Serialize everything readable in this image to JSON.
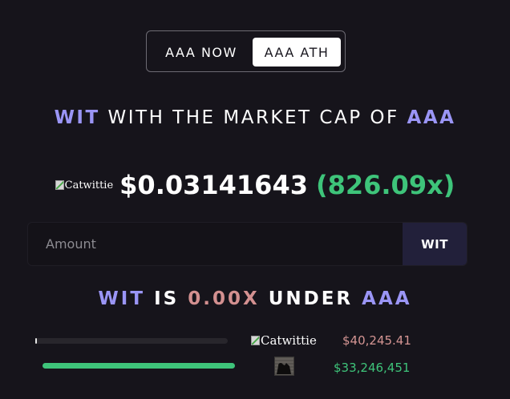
{
  "toggle": {
    "options": [
      "AAA NOW",
      "AAA ATH"
    ],
    "selected": "AAA ATH"
  },
  "heading": {
    "token": "WIT",
    "middle": "WITH THE MARKET CAP OF",
    "target": "AAA"
  },
  "price": {
    "image_alt": "Catwittie",
    "value": "$0.03141643",
    "multiplier": "(826.09x)"
  },
  "amount": {
    "placeholder": "Amount",
    "value": "",
    "unit": "WIT"
  },
  "comparison": {
    "token": "WIT",
    "is": "IS",
    "ratio": "0.00X",
    "under": "UNDER",
    "target": "AAA"
  },
  "rows": [
    {
      "image_alt": "Catwittie",
      "value": "$40,245.41",
      "bar_fraction": 0.0012,
      "bar_color": "#e6e6e6"
    },
    {
      "image_alt": "",
      "value": "$33,246,451",
      "bar_fraction": 1.0,
      "bar_color": "#3ec47a"
    }
  ],
  "colors": {
    "background": "#16141b",
    "accent_purple": "#9a95f5",
    "green": "#3ec47a",
    "rose": "#d39090"
  }
}
